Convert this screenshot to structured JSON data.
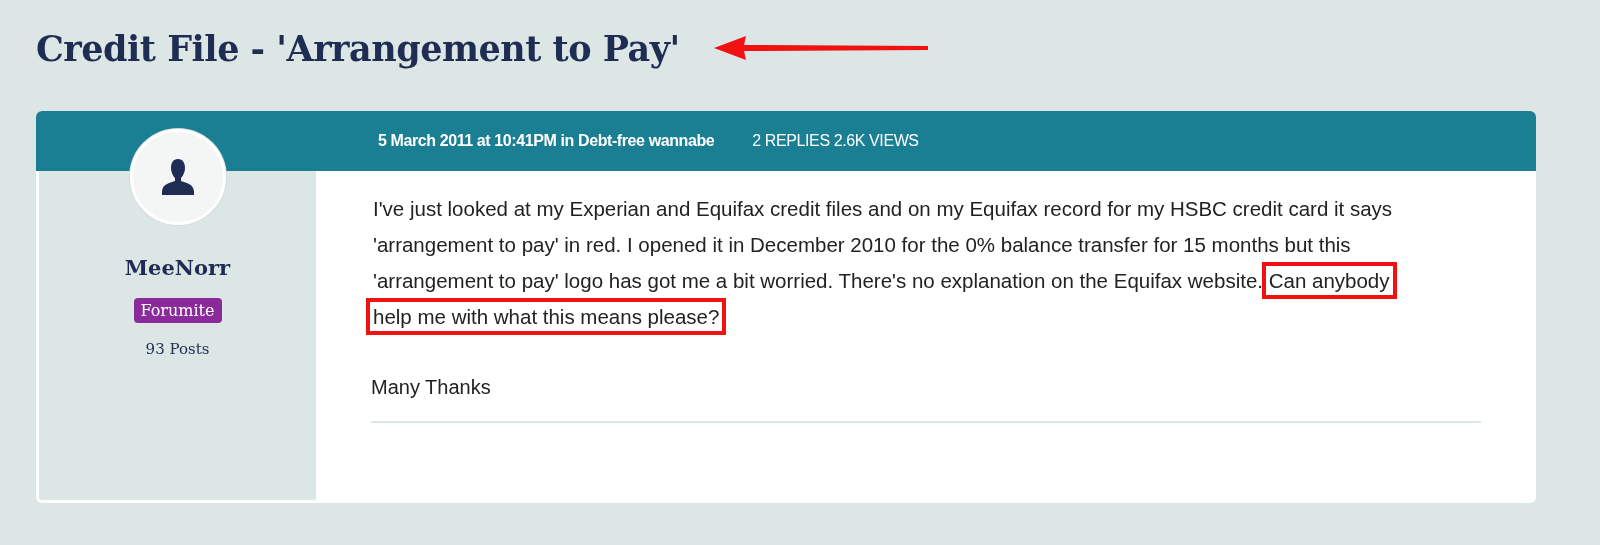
{
  "title": "Credit File - 'Arrangement to Pay'",
  "post": {
    "date": "5 March 2011 at 10:41PM in Debt-free wannabe",
    "stats": "2 REPLIES 2.6K VIEWS",
    "author": {
      "name": "MeeNorr",
      "rank": "Forumite",
      "posts": "93 Posts"
    },
    "body": [
      {
        "text": "I've just looked at my Experian and Equifax credit files and on my Equifax record for my HSBC credit card it says 'arrangement to pay' in red. I opened it in December 2010 for the 0% balance transfer for 15 months but this 'arrangement to pay' logo has got me a bit worried. There's no explanation on the Equifax website.",
        "highlighted": false
      },
      {
        "text": "Can anybody help me with what this means please?",
        "highlighted": true
      }
    ],
    "signoff": "Many Thanks"
  }
}
